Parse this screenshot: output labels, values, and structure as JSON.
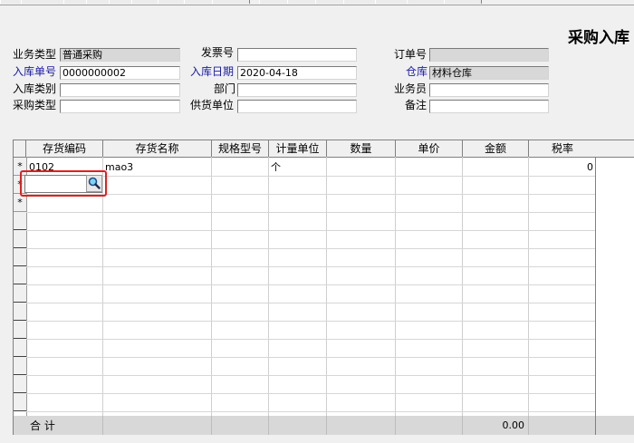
{
  "header": {
    "title": "采购入库"
  },
  "form": {
    "business_type_label": "业务类型",
    "business_type_value": "普通采购",
    "invoice_no_label": "发票号",
    "invoice_no_value": "",
    "order_no_label": "订单号",
    "order_no_value": "",
    "receipt_no_label": "入库单号",
    "receipt_no_value": "0000000002",
    "receipt_date_label": "入库日期",
    "receipt_date_value": "2020-04-18",
    "warehouse_label": "仓库",
    "warehouse_value": "材料仓库",
    "receipt_category_label": "入库类别",
    "receipt_category_value": "",
    "department_label": "部门",
    "department_value": "",
    "salesperson_label": "业务员",
    "salesperson_value": "",
    "purchase_type_label": "采购类型",
    "purchase_type_value": "",
    "supplier_label": "供货单位",
    "supplier_value": "",
    "remark_label": "备注",
    "remark_value": ""
  },
  "grid": {
    "columns": [
      "存货编码",
      "存货名称",
      "规格型号",
      "计量单位",
      "数量",
      "单价",
      "金额",
      "税率"
    ],
    "rows": [
      {
        "marker": "*",
        "code": "0102",
        "name": "mao3",
        "unit": "个",
        "tax_rate": "0"
      },
      {
        "marker": "*",
        "code": "",
        "name": "",
        "unit": "",
        "tax_rate": ""
      },
      {
        "marker": "*",
        "code": "",
        "name": "",
        "unit": "",
        "tax_rate": ""
      }
    ],
    "total_label": "合 计",
    "total_amount": "0.00"
  },
  "icons": {
    "search": "search-icon"
  },
  "colors": {
    "label_blue": "#1a1aa6",
    "highlight_red": "#e0201f"
  }
}
